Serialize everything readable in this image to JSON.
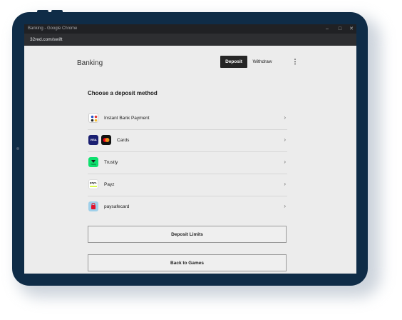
{
  "window": {
    "title": "Banking - Google Chrome",
    "controls": {
      "minimize": "–",
      "maximize": "□",
      "close": "✕"
    }
  },
  "browser": {
    "url": "32red.com/swift"
  },
  "header": {
    "title": "Banking",
    "tabs": [
      {
        "label": "Deposit",
        "active": true
      },
      {
        "label": "Withdraw",
        "active": false
      }
    ],
    "menu_glyph": "⋮"
  },
  "deposit": {
    "section_title": "Choose a deposit method",
    "methods": [
      {
        "label": "Instant Bank Payment",
        "icon": "instant-bank-payment-icon"
      },
      {
        "label": "Cards",
        "icon": "visa-icon",
        "icon2": "mastercard-icon",
        "visa_text": "VISA"
      },
      {
        "label": "Trustly",
        "icon": "trustly-icon",
        "icon_text": "Trustly"
      },
      {
        "label": "Payz",
        "icon": "payz-icon",
        "icon_text": "payz."
      },
      {
        "label": "paysafecard",
        "icon": "paysafecard-icon"
      }
    ],
    "chevron": "›"
  },
  "buttons": {
    "deposit_limits": "Deposit Limits",
    "back_to_games": "Back to Games"
  },
  "colors": {
    "frame": "#0f2c47",
    "page_bg": "#ececec",
    "active_tab": "#262626",
    "trustly_green": "#0ee06e",
    "visa_navy": "#1a1f71",
    "paysafe_blue": "#9fd0ea",
    "paysafe_red": "#e3122b"
  }
}
